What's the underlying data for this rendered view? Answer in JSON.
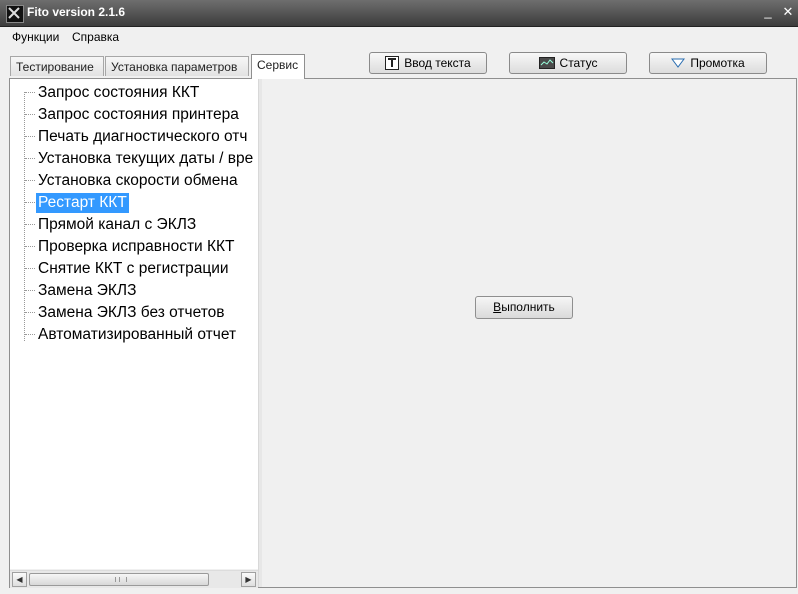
{
  "window": {
    "title": "Fito version 2.1.6",
    "minimize_glyph": "_",
    "close_glyph": "✕"
  },
  "menu": {
    "items": [
      "Функции",
      "Справка"
    ]
  },
  "tabs": [
    {
      "label": "Тестирование",
      "active": false
    },
    {
      "label": "Установка параметров",
      "active": false
    },
    {
      "label": "Сервис",
      "active": true
    }
  ],
  "toolbar": {
    "text_input": {
      "label": "Ввод текста",
      "icon": "text-icon"
    },
    "status": {
      "label": "Статус",
      "icon": "monitor-icon"
    },
    "scroll": {
      "label": "Промотка",
      "icon": "triangle-down-icon"
    }
  },
  "tree": {
    "selected_index": 5,
    "items": [
      "Запрос состояния ККТ",
      "Запрос состояния принтера",
      "Печать диагностического отч",
      "Установка текущих даты / вре",
      "Установка скорости обмена",
      "Рестарт ККТ",
      "Прямой канал с ЭКЛЗ",
      "Проверка исправности ККТ",
      "Снятие ККТ с регистрации",
      "Замена ЭКЛЗ",
      "Замена ЭКЛЗ без отчетов",
      "Автоматизированный отчет"
    ]
  },
  "execute_button": {
    "accel": "В",
    "rest": "ыполнить"
  },
  "colors": {
    "selection": "#3399ff",
    "titlebar": "#4a4a4a"
  }
}
